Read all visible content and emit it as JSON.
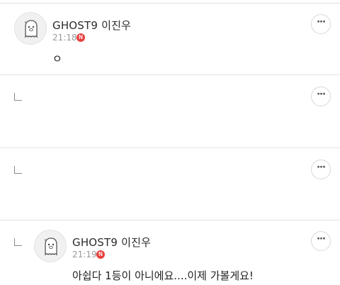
{
  "comments": [
    {
      "author": "GHOST9 이진우",
      "time": "21:18",
      "badge": "N",
      "text": "ㅇ",
      "more": "···"
    },
    {
      "reply": true,
      "more": "···"
    },
    {
      "reply": true,
      "more": "···"
    },
    {
      "reply": true,
      "author": "GHOST9 이진우",
      "time": "21:19",
      "badge": "N",
      "text": "아쉽다 1등이 아니에요....이제 가볼게요!",
      "more": "···"
    }
  ],
  "colors": {
    "badge": "#e8403e",
    "divider": "#e2e2e2",
    "time": "#9a9a9a"
  },
  "icons": {
    "avatar": "ghost-character-icon",
    "reply": "reply-arrow-icon",
    "more": "more-options-icon"
  }
}
